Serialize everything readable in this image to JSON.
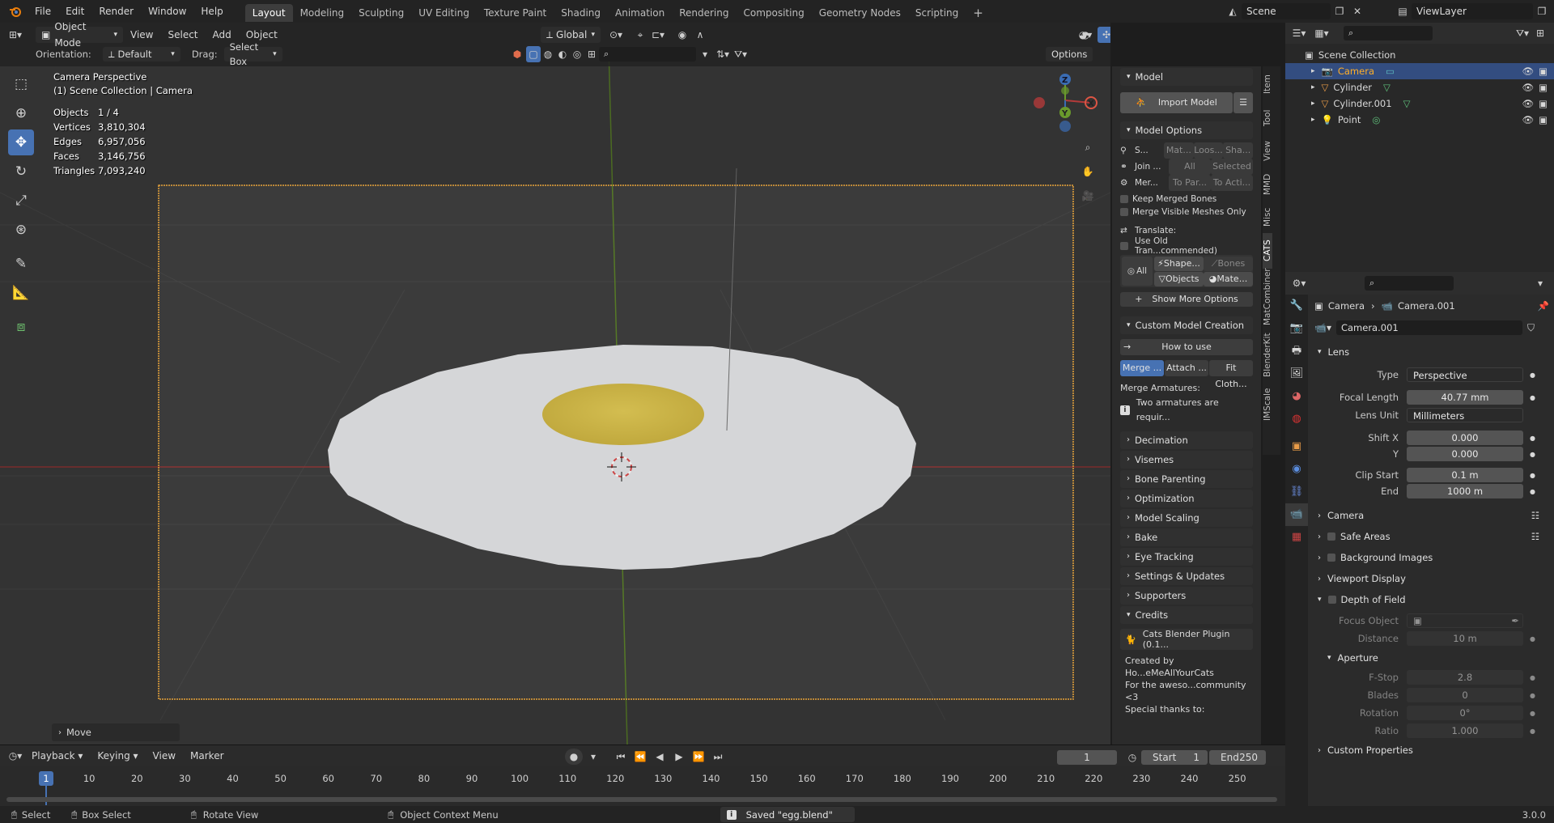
{
  "topbar": {
    "menus": [
      "File",
      "Edit",
      "Render",
      "Window",
      "Help"
    ],
    "workspaces": [
      "Layout",
      "Modeling",
      "Sculpting",
      "UV Editing",
      "Texture Paint",
      "Shading",
      "Animation",
      "Rendering",
      "Compositing",
      "Geometry Nodes",
      "Scripting"
    ],
    "active_workspace": "Layout",
    "scene": "Scene",
    "view_layer": "ViewLayer"
  },
  "viewport_header": {
    "mode": "Object Mode",
    "menus": [
      "View",
      "Select",
      "Add",
      "Object"
    ],
    "transform_orientation": "Global",
    "orientation_label": "Orientation:",
    "orientation_value": "Default",
    "drag_label": "Drag:",
    "drag_value": "Select Box",
    "options": "Options"
  },
  "overlay": {
    "title": "Camera Perspective",
    "subtitle": "(1) Scene Collection | Camera",
    "stats": [
      {
        "label": "Objects",
        "value": "1 / 4"
      },
      {
        "label": "Vertices",
        "value": "3,810,304"
      },
      {
        "label": "Edges",
        "value": "6,957,056"
      },
      {
        "label": "Faces",
        "value": "3,146,756"
      },
      {
        "label": "Triangles",
        "value": "7,093,240"
      }
    ],
    "last_op": "Move"
  },
  "npanel": {
    "model_header": "Model",
    "import_model": "Import Model",
    "model_options_header": "Model Options",
    "opt_row1": [
      "S...",
      "Mat...",
      "Loos...",
      "Sha..."
    ],
    "opt_row2": [
      "Join ...",
      "All",
      "Selected"
    ],
    "opt_row3": [
      "Mer...",
      "To Par...",
      "To Acti..."
    ],
    "keep_merged_bones": "Keep Merged Bones",
    "merge_visible": "Merge Visible Meshes Only",
    "translate": "Translate:",
    "use_old_tran": "Use Old Tran...commended)",
    "all": "All",
    "shape": "Shape...",
    "bones": "Bones",
    "objects": "Objects",
    "mate": "Mate...",
    "show_more": "Show More Options",
    "custom_header": "Custom Model Creation",
    "how_to_use": "How to use",
    "tabs3": [
      "Merge ...",
      "Attach ...",
      "Fit Cloth..."
    ],
    "merge_armatures": "Merge Armatures:",
    "two_armatures": "Two armatures are requir...",
    "sections": [
      "Decimation",
      "Visemes",
      "Bone Parenting",
      "Optimization",
      "Model Scaling",
      "Bake",
      "Eye Tracking",
      "Settings & Updates",
      "Supporters"
    ],
    "credits_header": "Credits",
    "credits_plugin": "Cats Blender Plugin (0.1...",
    "credits_line1": "Created by Ho...eMeAllYourCats",
    "credits_line2": "For the aweso...community <3",
    "credits_line3": "Special thanks to:",
    "vtabs": [
      "Item",
      "Tool",
      "View",
      "MMD",
      "Misc",
      "CATS",
      "MatCombiner",
      "BlenderKit",
      "IMScale"
    ]
  },
  "outliner": {
    "root": "Scene Collection",
    "items": [
      "Camera",
      "Cylinder",
      "Cylinder.001",
      "Point"
    ]
  },
  "properties": {
    "breadcrumb_object": "Camera",
    "breadcrumb_data": "Camera.001",
    "datablock": "Camera.001",
    "lens_header": "Lens",
    "type_label": "Type",
    "type_value": "Perspective",
    "focal_label": "Focal Length",
    "focal_value": "40.77 mm",
    "lens_unit_label": "Lens Unit",
    "lens_unit_value": "Millimeters",
    "shiftx_label": "Shift X",
    "shiftx_value": "0.000",
    "shifty_label": "Y",
    "shifty_value": "0.000",
    "clip_start_label": "Clip Start",
    "clip_start_value": "0.1 m",
    "clip_end_label": "End",
    "clip_end_value": "1000 m",
    "camera_header": "Camera",
    "safe_areas": "Safe Areas",
    "bg_images": "Background Images",
    "viewport_display": "Viewport Display",
    "dof": "Depth of Field",
    "focus_label": "Focus Object",
    "distance_label": "Distance",
    "distance_value": "10 m",
    "aperture": "Aperture",
    "fstop_label": "F-Stop",
    "fstop_value": "2.8",
    "blades_label": "Blades",
    "blades_value": "0",
    "rotation_label": "Rotation",
    "rotation_value": "0°",
    "ratio_label": "Ratio",
    "ratio_value": "1.000",
    "custom_props": "Custom Properties"
  },
  "timeline": {
    "menus": [
      "Playback",
      "Keying",
      "View",
      "Marker"
    ],
    "current_frame": "1",
    "start_label": "Start",
    "start": "1",
    "end_label": "End",
    "end": "250",
    "ticks": [
      "1",
      "10",
      "20",
      "30",
      "40",
      "50",
      "60",
      "70",
      "80",
      "90",
      "100",
      "110",
      "120",
      "130",
      "140",
      "150",
      "160",
      "170",
      "180",
      "190",
      "200",
      "210",
      "220",
      "230",
      "240",
      "250"
    ]
  },
  "status": {
    "select": "Select",
    "box_select": "Box Select",
    "rotate_view": "Rotate View",
    "context_menu": "Object Context Menu",
    "message": "Saved \"egg.blend\"",
    "version": "3.0.0"
  },
  "colors": {
    "accent": "#4772b3",
    "camera_frame": "#e8a33a",
    "egg_white": "#d6d7d9",
    "yolk": "#cdb748",
    "x_axis": "#b33a3a",
    "y_axis": "#6a9a2c"
  }
}
